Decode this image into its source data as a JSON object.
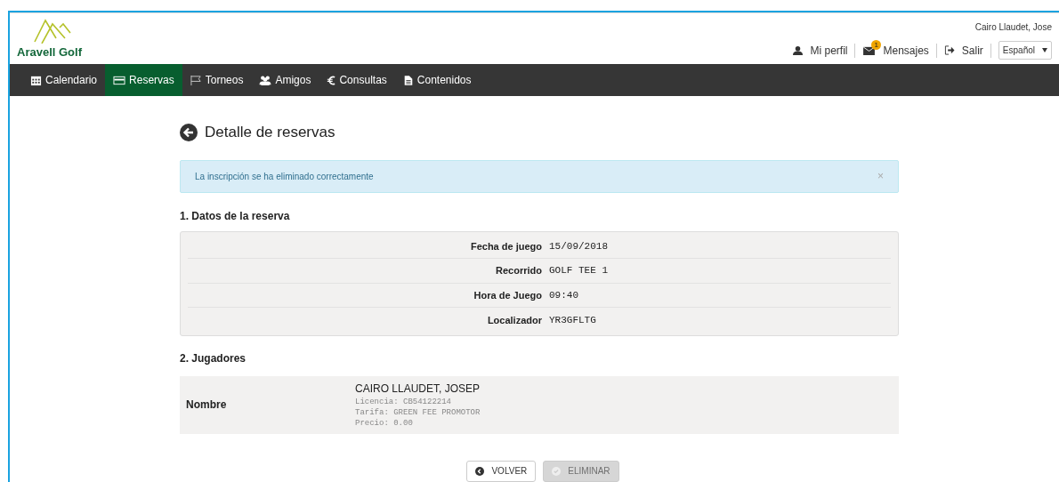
{
  "brand": {
    "name": "Aravell Golf"
  },
  "user": {
    "name": "Cairo Llaudet, Jose"
  },
  "top_links": [
    {
      "kind": "profile",
      "label": "Mi perfil"
    },
    {
      "kind": "messages",
      "label": "Mensajes",
      "badge": "1"
    },
    {
      "kind": "logout",
      "label": "Salir"
    }
  ],
  "language": {
    "value": "Español"
  },
  "nav": [
    {
      "kind": "calendar",
      "label": "Calendario",
      "selected": false
    },
    {
      "kind": "card",
      "label": "Reservas",
      "selected": true
    },
    {
      "kind": "flag",
      "label": "Torneos",
      "selected": false
    },
    {
      "kind": "group",
      "label": "Amigos",
      "selected": false
    },
    {
      "kind": "euro",
      "label": "Consultas",
      "selected": false
    },
    {
      "kind": "document",
      "label": "Contenidos",
      "selected": false
    }
  ],
  "page_title": "Detalle de reservas",
  "alert": {
    "text": "La inscripción se ha eliminado correctamente",
    "close": "×"
  },
  "section_1": {
    "title": "1. Datos de la reserva",
    "rows": [
      {
        "label": "Fecha de juego",
        "value": "15/09/2018"
      },
      {
        "label": "Recorrido",
        "value": "GOLF TEE 1"
      },
      {
        "label": "Hora de Juego",
        "value": "09:40"
      },
      {
        "label": "Localizador",
        "value": "YR3GFLTG"
      }
    ]
  },
  "section_2": {
    "title": "2. Jugadores",
    "label": "Nombre",
    "players": [
      {
        "name": "CAIRO LLAUDET, JOSEP",
        "details": [
          "Licencia: CB54122214",
          "Tarifa: GREEN FEE PROMOTOR",
          "Precio: 0.00"
        ]
      }
    ]
  },
  "buttons": [
    {
      "kind": "back",
      "label": "VOLVER",
      "disabled": false
    },
    {
      "kind": "check",
      "label": "ELIMINAR",
      "disabled": true
    }
  ]
}
